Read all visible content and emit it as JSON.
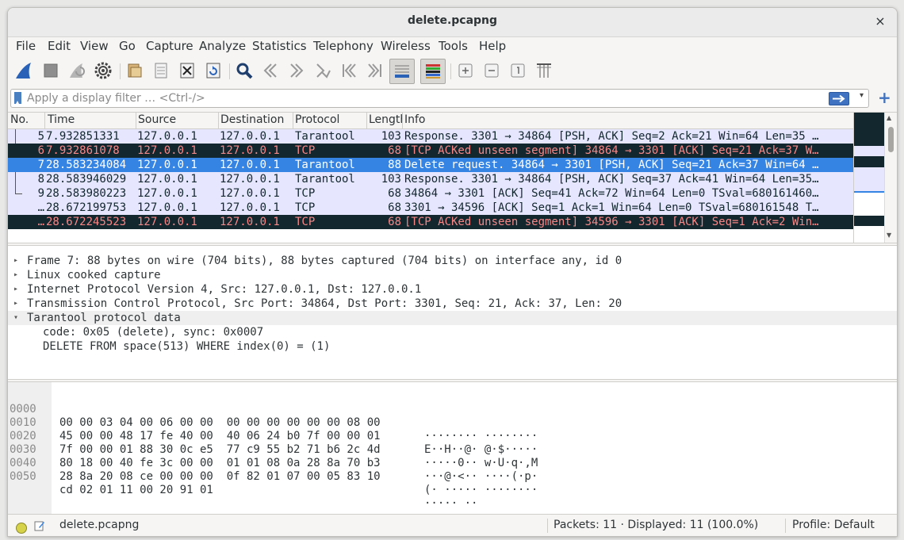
{
  "window": {
    "title": "delete.pcapng",
    "close_label": "×"
  },
  "menu": [
    "File",
    "Edit",
    "View",
    "Go",
    "Capture",
    "Analyze",
    "Statistics",
    "Telephony",
    "Wireless",
    "Tools",
    "Help"
  ],
  "toolbar_icons": [
    "shark-fin-icon",
    "stop-icon",
    "restart-icon",
    "options-gear-icon",
    "open-folder-icon",
    "save-file-icon",
    "close-file-icon",
    "reload-icon",
    "find-icon",
    "go-back-icon",
    "go-forward-icon",
    "go-to-packet-icon",
    "first-packet-icon",
    "last-packet-icon",
    "autoscroll-icon",
    "colorize-icon",
    "zoom-in-icon",
    "zoom-out-icon",
    "zoom-reset-icon",
    "resize-columns-icon"
  ],
  "filter": {
    "placeholder": "Apply a display filter … <Ctrl-/>",
    "plus": "+"
  },
  "packet_list": {
    "columns": [
      "No.",
      "Time",
      "Source",
      "Destination",
      "Protocol",
      "Length",
      "Info"
    ],
    "rows": [
      {
        "no": "5",
        "time": "7.932851331",
        "src": "127.0.0.1",
        "dst": "127.0.0.1",
        "proto": "Tarantool",
        "len": "103",
        "info": "Response. 3301 → 34864 [PSH, ACK] Seq=2 Ack=21 Win=64 Len=35 …",
        "style": "lav"
      },
      {
        "no": "6",
        "time": "7.932861078",
        "src": "127.0.0.1",
        "dst": "127.0.0.1",
        "proto": "TCP",
        "len": "68",
        "info": "[TCP ACKed unseen segment] 34864 → 3301 [ACK] Seq=21 Ack=37 W…",
        "style": "dark"
      },
      {
        "no": "7",
        "time": "28.583234084",
        "src": "127.0.0.1",
        "dst": "127.0.0.1",
        "proto": "Tarantool",
        "len": "88",
        "info": "Delete request. 34864 → 3301 [PSH, ACK] Seq=21 Ack=37 Win=64 …",
        "style": "sel"
      },
      {
        "no": "8",
        "time": "28.583946029",
        "src": "127.0.0.1",
        "dst": "127.0.0.1",
        "proto": "Tarantool",
        "len": "103",
        "info": "Response. 3301 → 34864 [PSH, ACK] Seq=37 Ack=41 Win=64 Len=35…",
        "style": "lav"
      },
      {
        "no": "9",
        "time": "28.583980223",
        "src": "127.0.0.1",
        "dst": "127.0.0.1",
        "proto": "TCP",
        "len": "68",
        "info": "34864 → 3301 [ACK] Seq=41 Ack=72 Win=64 Len=0 TSval=680161460…",
        "style": "lav"
      },
      {
        "no": "…",
        "time": "28.672199753",
        "src": "127.0.0.1",
        "dst": "127.0.0.1",
        "proto": "TCP",
        "len": "68",
        "info": "3301 → 34596 [ACK] Seq=1 Ack=1 Win=64 Len=0 TSval=680161548 T…",
        "style": "lav"
      },
      {
        "no": "…",
        "time": "28.672245523",
        "src": "127.0.0.1",
        "dst": "127.0.0.1",
        "proto": "TCP",
        "len": "68",
        "info": "[TCP ACKed unseen segment] 34596 → 3301 [ACK] Seq=1 Ack=2 Win…",
        "style": "dark"
      }
    ]
  },
  "details": {
    "frame": "Frame 7: 88 bytes on wire (704 bits), 88 bytes captured (704 bits) on interface any, id 0",
    "linux": "Linux cooked capture",
    "ip": "Internet Protocol Version 4, Src: 127.0.0.1, Dst: 127.0.0.1",
    "tcp": "Transmission Control Protocol, Src Port: 34864, Dst Port: 3301, Seq: 21, Ack: 37, Len: 20",
    "tarantool": "Tarantool protocol data",
    "code": "code: 0x05 (delete), sync: 0x0007",
    "query": "DELETE FROM space(513) WHERE index(0) = (1)",
    "collapsed_arrow": "▸",
    "expanded_arrow": "▾"
  },
  "bytes": [
    {
      "off": "0000",
      "hex": "00 00 03 04 00 06 00 00  00 00 00 00 00 00 08 00",
      "ascii": "········ ········"
    },
    {
      "off": "0010",
      "hex": "45 00 00 48 17 fe 40 00  40 06 24 b0 7f 00 00 01",
      "ascii": "E··H··@· @·$·····"
    },
    {
      "off": "0020",
      "hex": "7f 00 00 01 88 30 0c e5  77 c9 55 b2 71 b6 2c 4d",
      "ascii": "·····0·· w·U·q·,M"
    },
    {
      "off": "0030",
      "hex": "80 18 00 40 fe 3c 00 00  01 01 08 0a 28 8a 70 b3",
      "ascii": "···@·<·· ····(·p·"
    },
    {
      "off": "0040",
      "hex": "28 8a 20 08 ce 00 00 00  0f 82 01 07 00 05 83 10",
      "ascii": "(· ····· ········"
    },
    {
      "off": "0050",
      "hex": "cd 02 01 11 00 20 91 01",
      "ascii": "····· ··"
    }
  ],
  "status": {
    "file": "delete.pcapng",
    "packets": "Packets: 11 · Displayed: 11 (100.0%)",
    "profile": "Profile: Default"
  },
  "colors": {
    "selected": "#3584e4",
    "dark_row": "#12272e",
    "dark_text": "#f78787",
    "lavender": "#e7e6ff"
  }
}
